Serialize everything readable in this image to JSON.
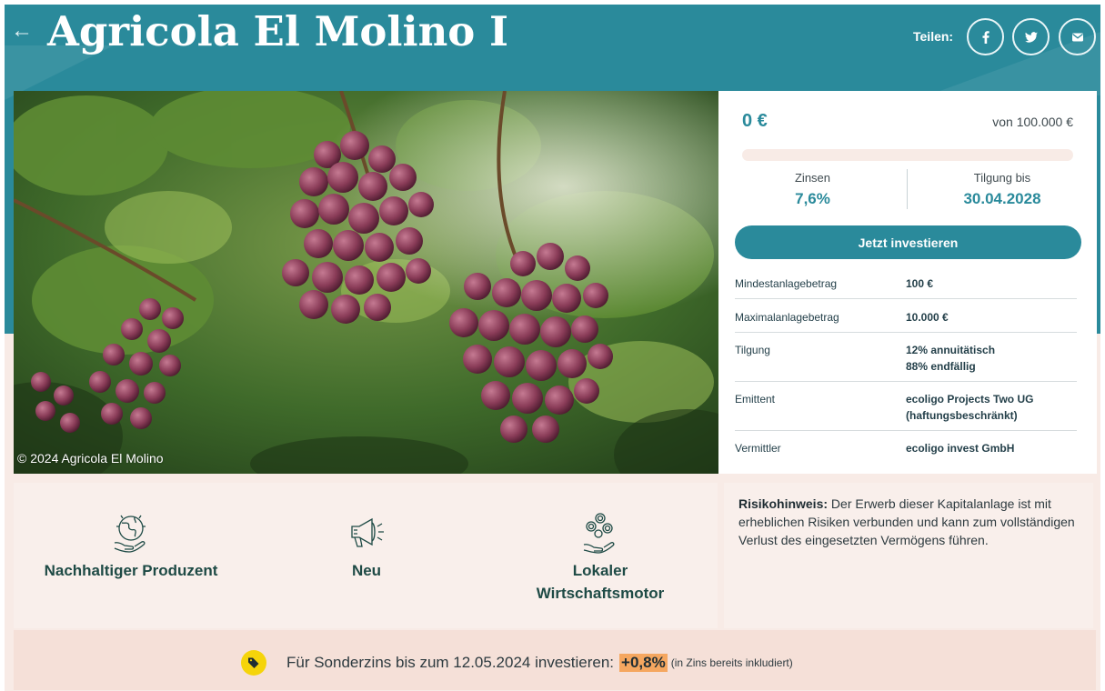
{
  "header": {
    "title": "Agricola El Molino I",
    "share_label": "Teilen:",
    "share_icons": [
      "facebook-icon",
      "twitter-icon",
      "mail-icon"
    ],
    "accent_color": "#2a8a9b"
  },
  "hero": {
    "copyright": "© 2024 Agricola El Molino"
  },
  "funding": {
    "amount": "0 €",
    "of_total": "von 100.000 €",
    "progress_percent": 0,
    "interest_label": "Zinsen",
    "interest_value": "7,6%",
    "repayment_label": "Tilgung bis",
    "repayment_value": "30.04.2028",
    "invest_button": "Jetzt investieren"
  },
  "details": [
    {
      "key": "Mindestanlagebetrag",
      "value": "100 €"
    },
    {
      "key": "Maximalanlagebetrag",
      "value": "10.000 €"
    },
    {
      "key": "Tilgung",
      "value": "12% annuitätisch",
      "value2": "88% endfällig"
    },
    {
      "key": "Emittent",
      "value": "ecoligo Projects Two UG",
      "value2": "(haftungsbeschränkt)"
    },
    {
      "key": "Vermittler",
      "value": "ecoligo invest GmbH"
    }
  ],
  "features": [
    {
      "icon": "globe-hands-icon",
      "label": "Nachhaltiger Produzent"
    },
    {
      "icon": "megaphone-icon",
      "label": "Neu"
    },
    {
      "icon": "coins-hand-icon",
      "label": "Lokaler",
      "label2": "Wirtschaftsmotor"
    }
  ],
  "risk": {
    "title": "Risikohinweis:",
    "text": "Der Erwerb dieser Kapitalanlage ist mit erheblichen Risiken verbunden und kann zum vollständigen Verlust des eingesetzten Vermögens führen."
  },
  "promo": {
    "icon": "tag-icon",
    "text": "Für Sonderzins bis zum 12.05.2024 investieren:",
    "bonus": "+0,8%",
    "note": "(in Zins bereits inkludiert)"
  }
}
